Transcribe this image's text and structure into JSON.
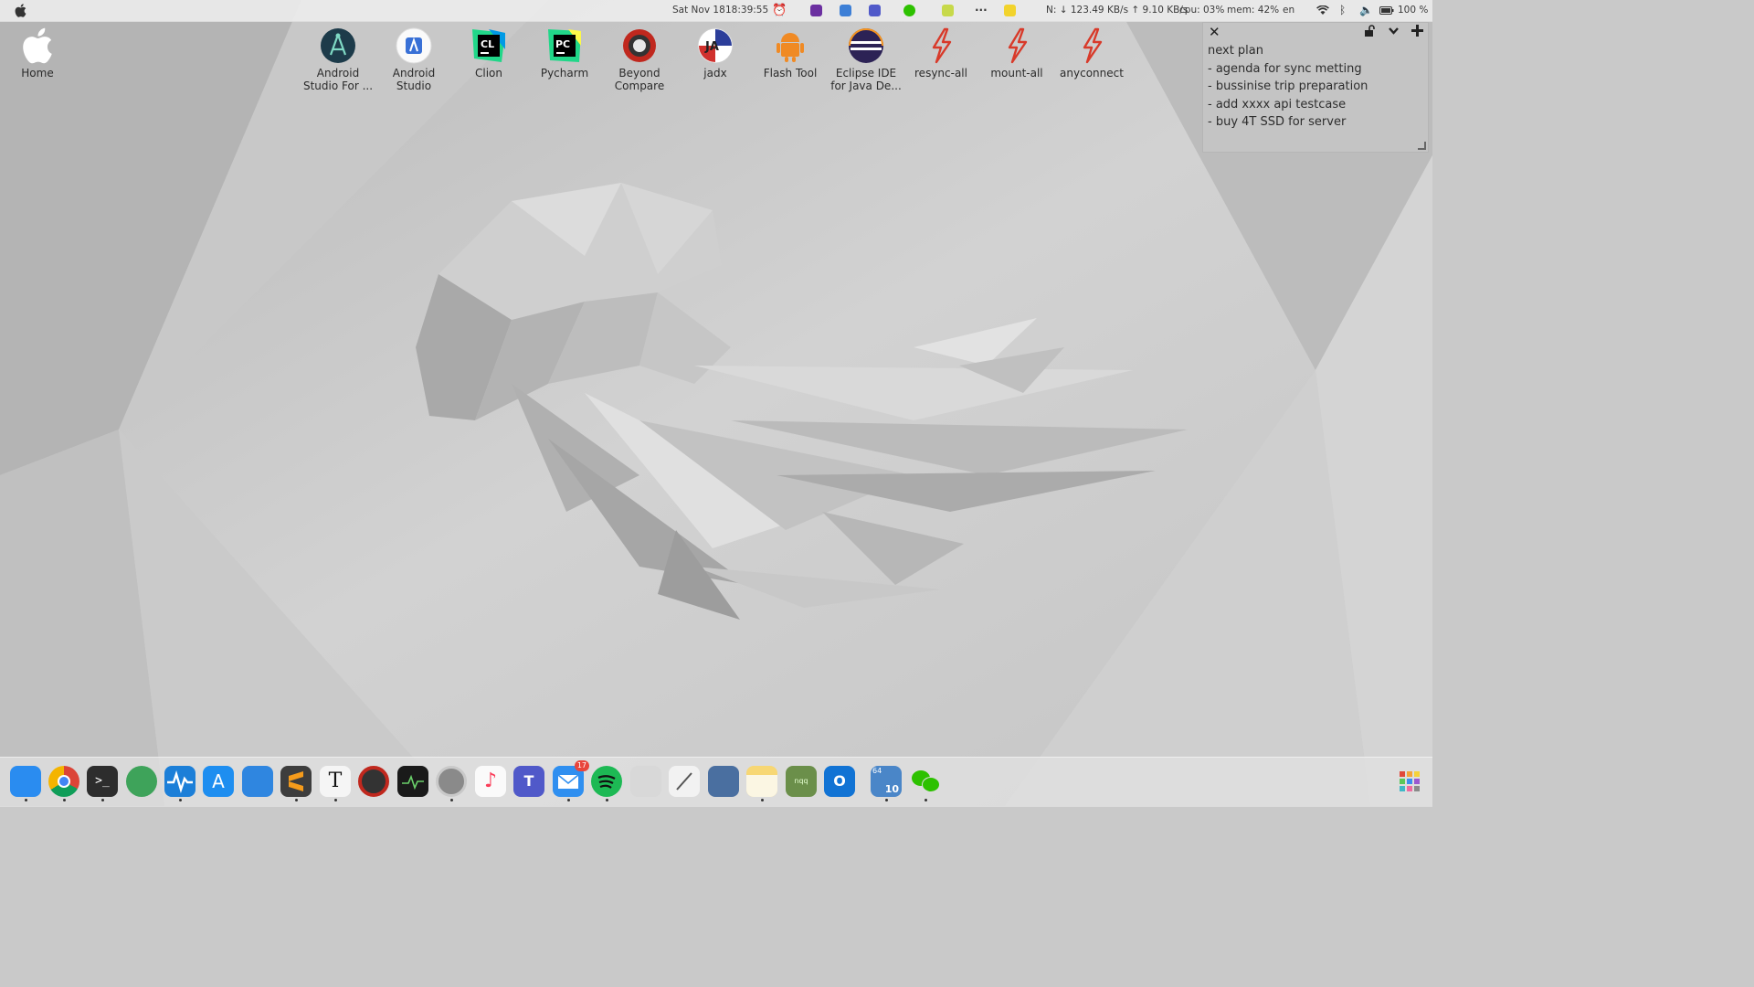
{
  "menubar": {
    "date": "Sat Nov 18",
    "time": "18:39:55",
    "network": "N: ↓ 123.49 KB/s ↑ 9.10 KB/s",
    "cpu": "cpu: 03%",
    "mem": "mem: 42%",
    "lang": "en",
    "battery": "100 %"
  },
  "desktop": {
    "home_label": "Home",
    "icons": [
      {
        "label": "Android Studio For ..."
      },
      {
        "label": "Android Studio"
      },
      {
        "label": "Clion"
      },
      {
        "label": "Pycharm"
      },
      {
        "label": "Beyond Compare"
      },
      {
        "label": "jadx"
      },
      {
        "label": "Flash Tool"
      },
      {
        "label": "Eclipse IDE for Java De..."
      },
      {
        "label": "resync-all"
      },
      {
        "label": "mount-all"
      },
      {
        "label": "anyconnect"
      }
    ]
  },
  "note": {
    "lines": [
      "next plan",
      "- agenda for sync metting",
      "- bussinise trip preparation",
      "- add xxxx api testcase",
      "- buy 4T SSD for server"
    ]
  },
  "dock": {
    "apps": [
      {
        "name": "finder",
        "color": "#2a8cf0"
      },
      {
        "name": "chrome",
        "color": "#e5e5e5"
      },
      {
        "name": "terminal",
        "color": "#2d2d2d"
      },
      {
        "name": "network-radar",
        "color": "#3ea35a"
      },
      {
        "name": "activity-monitor",
        "color": "#1c7fd8"
      },
      {
        "name": "app-store",
        "color": "#1e8ef0"
      },
      {
        "name": "transmit",
        "color": "#2f86e0"
      },
      {
        "name": "sublime-text",
        "color": "#3d3d3d"
      },
      {
        "name": "typora",
        "color": "#f5f5f5"
      },
      {
        "name": "beyond-compare",
        "color": "#333333"
      },
      {
        "name": "console",
        "color": "#1a1a1a"
      },
      {
        "name": "system-preferences",
        "color": "#8a8a8a"
      },
      {
        "name": "music",
        "color": "#fafafa"
      },
      {
        "name": "teams",
        "color": "#5059c9"
      },
      {
        "name": "mail",
        "color": "#2f8ff0"
      },
      {
        "name": "spotify",
        "color": "#1db954"
      },
      {
        "name": "preview",
        "color": "#d8d8d8"
      },
      {
        "name": "textedit",
        "color": "#f2f2f2"
      },
      {
        "name": "screenshot",
        "color": "#4a6fa0"
      },
      {
        "name": "notes",
        "color": "#f7d774"
      },
      {
        "name": "nqq",
        "color": "#6b8f4a"
      },
      {
        "name": "outlook",
        "color": "#1173d4"
      },
      {
        "name": "xcode",
        "color": "#4a86c8"
      },
      {
        "name": "wechat",
        "color": "#2dc100"
      }
    ],
    "mail_badge": "17",
    "xcode_badge": "10",
    "xcode_bits": "64"
  }
}
